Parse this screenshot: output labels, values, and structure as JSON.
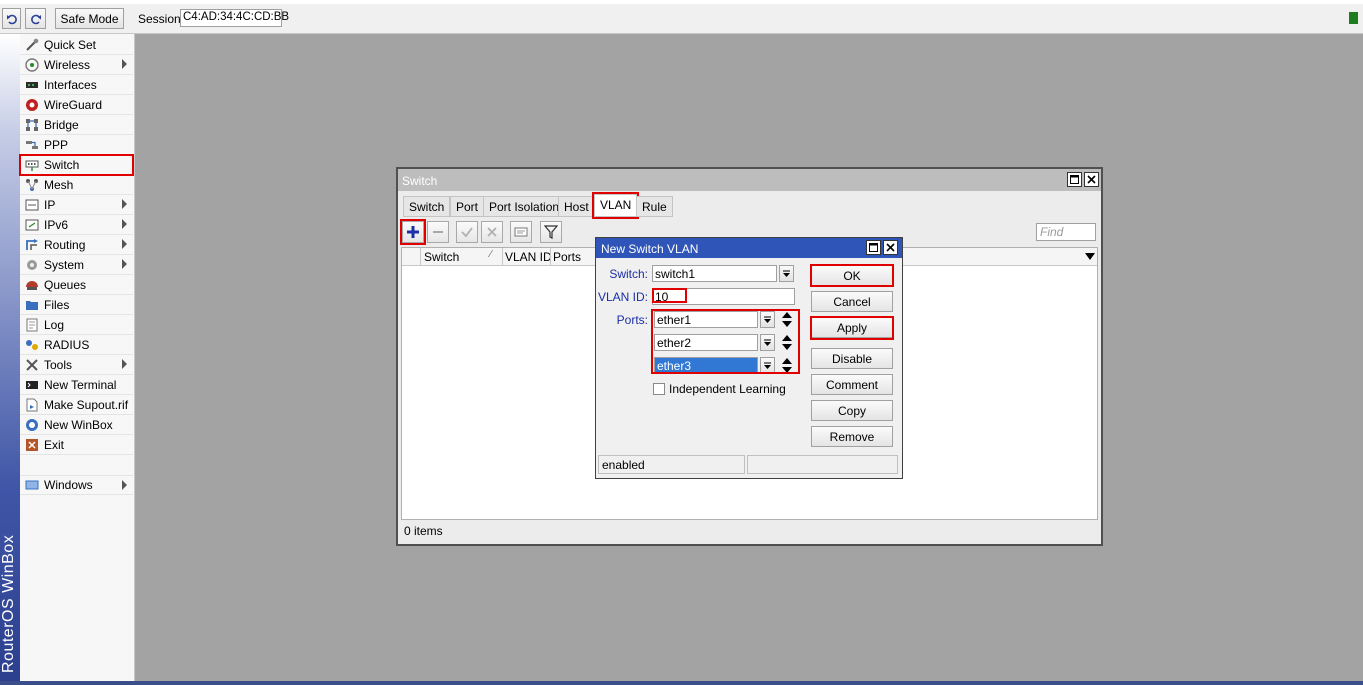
{
  "topbar": {
    "undo_icon": "undo-icon",
    "redo_icon": "redo-icon",
    "safe_mode_label": "Safe Mode",
    "session_label": "Session:",
    "session_value": "C4:AD:34:4C:CD:BB",
    "status_color": "#1e7d1e"
  },
  "brand": {
    "text": "RouterOS WinBox"
  },
  "menu": {
    "items": [
      {
        "label": "Quick Set",
        "icon": "quick-set-icon"
      },
      {
        "label": "Wireless",
        "icon": "wireless-icon"
      },
      {
        "label": "Interfaces",
        "icon": "interfaces-icon"
      },
      {
        "label": "WireGuard",
        "icon": "wireguard-icon"
      },
      {
        "label": "Bridge",
        "icon": "bridge-icon"
      },
      {
        "label": "PPP",
        "icon": "ppp-icon"
      },
      {
        "label": "Switch",
        "icon": "switch-icon"
      },
      {
        "label": "Mesh",
        "icon": "mesh-icon"
      },
      {
        "label": "IP",
        "icon": "ip-icon"
      },
      {
        "label": "IPv6",
        "icon": "ipv6-icon"
      },
      {
        "label": "Routing",
        "icon": "routing-icon"
      },
      {
        "label": "System",
        "icon": "system-icon"
      },
      {
        "label": "Queues",
        "icon": "queues-icon"
      },
      {
        "label": "Files",
        "icon": "files-icon"
      },
      {
        "label": "Log",
        "icon": "log-icon"
      },
      {
        "label": "RADIUS",
        "icon": "radius-icon"
      },
      {
        "label": "Tools",
        "icon": "tools-icon"
      },
      {
        "label": "New Terminal",
        "icon": "terminal-icon"
      },
      {
        "label": "Make Supout.rif",
        "icon": "supout-icon"
      },
      {
        "label": "New WinBox",
        "icon": "winbox-icon"
      },
      {
        "label": "Exit",
        "icon": "exit-icon"
      },
      {
        "label": "Windows",
        "icon": "windows-icon"
      }
    ]
  },
  "switch_window": {
    "title": "Switch",
    "tabs": [
      "Switch",
      "Port",
      "Port Isolation",
      "Host",
      "VLAN",
      "Rule"
    ],
    "active_tab": "VLAN",
    "find_placeholder": "Find",
    "columns": [
      "Switch",
      "VLAN ID",
      "Ports"
    ],
    "items_count": "0 items"
  },
  "dialog": {
    "title": "New Switch VLAN",
    "switch_label": "Switch:",
    "switch_value": "switch1",
    "vlan_id_label": "VLAN ID:",
    "vlan_id_value": "10",
    "ports_label": "Ports:",
    "ports": [
      "ether1",
      "ether2",
      "ether3"
    ],
    "independent_learning_label": "Independent Learning",
    "independent_learning_checked": false,
    "buttons": {
      "ok": "OK",
      "cancel": "Cancel",
      "apply": "Apply",
      "disable": "Disable",
      "comment": "Comment",
      "copy": "Copy",
      "remove": "Remove"
    },
    "status": "enabled"
  }
}
